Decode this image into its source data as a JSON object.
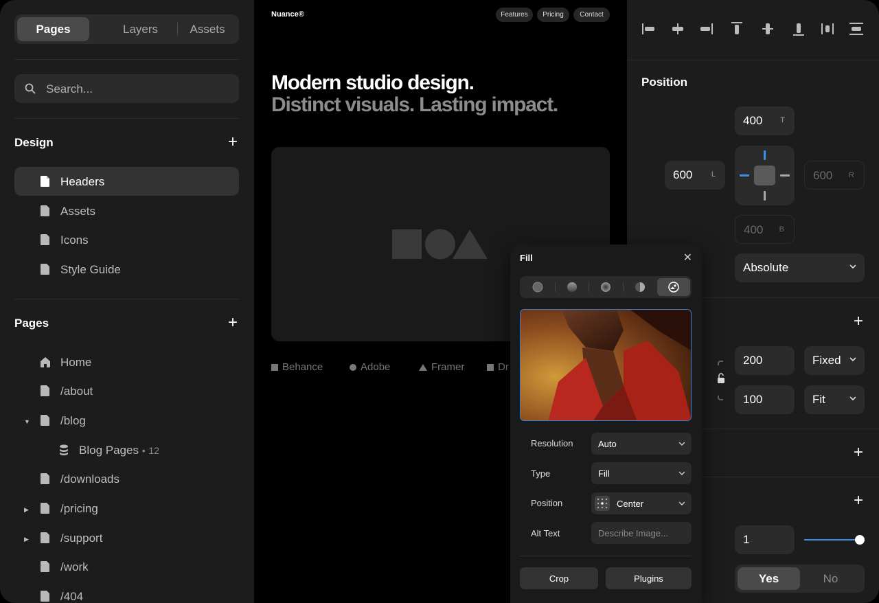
{
  "sidebar": {
    "tabs": [
      {
        "label": "Pages"
      },
      {
        "label": "Layers"
      },
      {
        "label": "Assets"
      }
    ],
    "search_placeholder": "Search...",
    "design": {
      "title": "Design",
      "items": [
        {
          "label": "Headers"
        },
        {
          "label": "Assets"
        },
        {
          "label": "Icons"
        },
        {
          "label": "Style Guide"
        }
      ]
    },
    "pages": {
      "title": "Pages",
      "items": [
        {
          "label": "Home"
        },
        {
          "label": "/about"
        },
        {
          "label": "/blog"
        },
        {
          "label": "Blog Pages",
          "count": "12"
        },
        {
          "label": "/downloads"
        },
        {
          "label": "/pricing"
        },
        {
          "label": "/support"
        },
        {
          "label": "/work"
        },
        {
          "label": "/404"
        }
      ]
    }
  },
  "canvas": {
    "brand": "Nuance®",
    "nav": [
      {
        "label": "Features"
      },
      {
        "label": "Pricing"
      },
      {
        "label": "Contact"
      }
    ],
    "headline": "Modern studio design.",
    "subheadline": "Distinct visuals. Lasting impact.",
    "logos": [
      {
        "label": "Behance"
      },
      {
        "label": "Adobe"
      },
      {
        "label": "Framer"
      },
      {
        "label": "Dr"
      }
    ]
  },
  "inspector": {
    "position": {
      "title": "Position",
      "top": {
        "value": "400",
        "unit": "T"
      },
      "left": {
        "value": "600",
        "unit": "L"
      },
      "right": {
        "value": "600",
        "unit": "R"
      },
      "bottom": {
        "value": "400",
        "unit": "B"
      },
      "mode": "Absolute"
    },
    "size": {
      "width": {
        "value": "200",
        "mode": "Fixed"
      },
      "height": {
        "value": "100",
        "mode": "Fit"
      }
    },
    "opacity": {
      "value": "1",
      "fraction": 1
    },
    "toggle": {
      "yes": "Yes",
      "no": "No",
      "selected": "Yes"
    }
  },
  "fill_popover": {
    "title": "Fill",
    "rows": [
      {
        "label": "Resolution",
        "value": "Auto"
      },
      {
        "label": "Type",
        "value": "Fill"
      },
      {
        "label": "Position",
        "value": "Center"
      },
      {
        "label": "Alt Text",
        "placeholder": "Describe Image..."
      }
    ],
    "buttons": {
      "crop": "Crop",
      "plugins": "Plugins"
    }
  },
  "colors": {
    "accent": "#3a8fe8",
    "panel": "#1c1c1c",
    "field": "#2b2b2b"
  }
}
